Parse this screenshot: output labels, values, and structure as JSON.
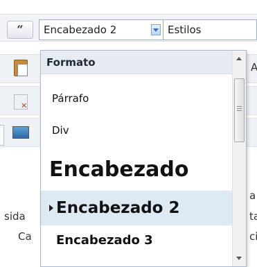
{
  "toolbar": {
    "blockquote_label": "“",
    "format_combo_value": "Encabezado 2",
    "styles_combo_value": "Estilos"
  },
  "background_fragments": {
    "right_top": "A",
    "left_bottom_1": "sida",
    "left_bottom_2": "Ca",
    "right_bottom_1": "a",
    "right_bottom_2": "ta",
    "right_bottom_3": "ci"
  },
  "format_dropdown": {
    "header": "Formato",
    "items": [
      {
        "label": "Párrafo",
        "selected": false
      },
      {
        "label": "Div",
        "selected": false
      },
      {
        "label": "Encabezado",
        "selected": false
      },
      {
        "label": "Encabezado 2",
        "selected": true
      },
      {
        "label": "Encabezado 3",
        "selected": false
      }
    ]
  },
  "icons": [
    "quote-icon",
    "paste-icon",
    "table-delete-icon",
    "image-icon",
    "chevron-down-icon",
    "arrow-up-icon",
    "arrow-down-icon",
    "selected-arrow-icon"
  ],
  "colors": {
    "selected_item_bg": "#dde9f3",
    "header_bg": "#e6ebf1",
    "combo_arrow": "#2f6fd0"
  }
}
